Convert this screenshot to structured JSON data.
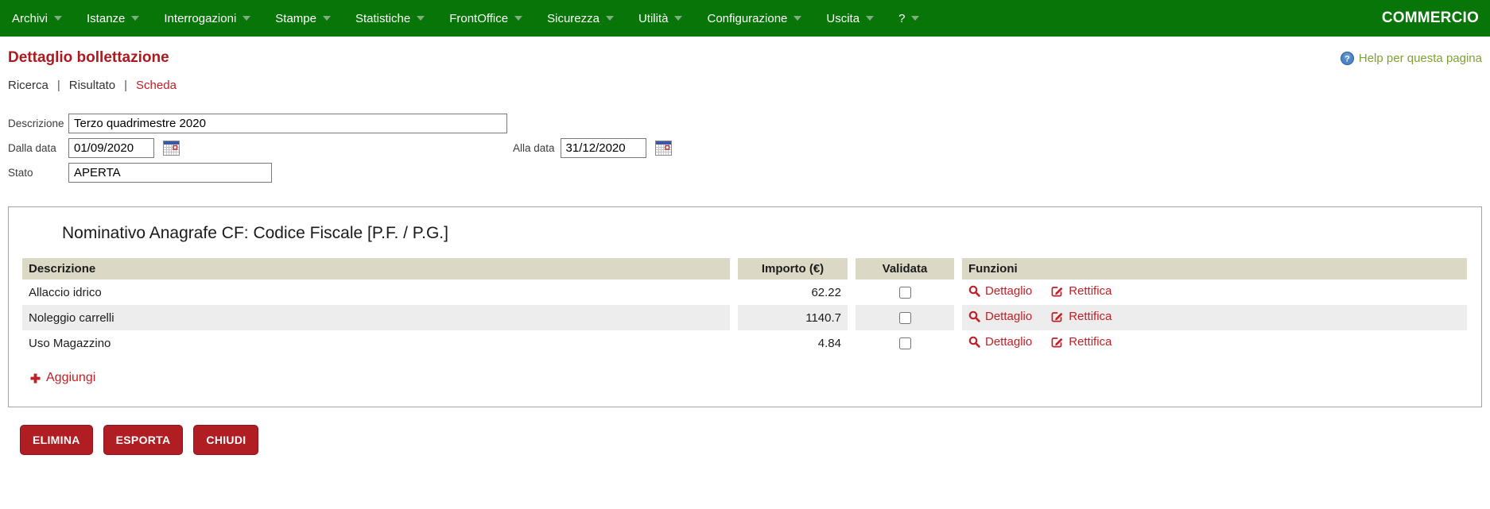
{
  "menu": {
    "items": [
      {
        "id": "archivi",
        "label": "Archivi"
      },
      {
        "id": "istanze",
        "label": "Istanze"
      },
      {
        "id": "interrogazioni",
        "label": "Interrogazioni"
      },
      {
        "id": "stampe",
        "label": "Stampe"
      },
      {
        "id": "statistiche",
        "label": "Statistiche"
      },
      {
        "id": "frontoffice",
        "label": "FrontOffice"
      },
      {
        "id": "sicurezza",
        "label": "Sicurezza"
      },
      {
        "id": "utilita",
        "label": "Utilità"
      },
      {
        "id": "configurazione",
        "label": "Configurazione"
      },
      {
        "id": "uscita",
        "label": "Uscita"
      },
      {
        "id": "help",
        "label": "?"
      }
    ],
    "brand": "COMMERCIO"
  },
  "header": {
    "title": "Dettaglio bollettazione",
    "help_label": "Help per questa pagina",
    "help_icon": "question-circle-icon"
  },
  "breadcrumb": {
    "separator": "|",
    "items": [
      {
        "id": "ricerca",
        "label": "Ricerca",
        "active": false
      },
      {
        "id": "risultato",
        "label": "Risultato",
        "active": false
      },
      {
        "id": "scheda",
        "label": "Scheda",
        "active": true
      }
    ]
  },
  "form": {
    "descrizione": {
      "label": "Descrizione",
      "value": "Terzo quadrimestre 2020"
    },
    "dalla_data": {
      "label": "Dalla data",
      "value": "01/09/2020",
      "picker_icon": "calendar-icon"
    },
    "alla_data": {
      "label": "Alla data",
      "value": "31/12/2020",
      "picker_icon": "calendar-icon"
    },
    "stato": {
      "label": "Stato",
      "value": "APERTA"
    }
  },
  "panel": {
    "heading": "Nominativo Anagrafe CF: Codice Fiscale [P.F. / P.G.]",
    "table": {
      "columns": [
        "Descrizione",
        "Importo (€)",
        "Validata",
        "Funzioni"
      ],
      "rows": [
        {
          "descrizione": "Allaccio idrico",
          "importo": "62.22",
          "validata": false
        },
        {
          "descrizione": "Noleggio carrelli",
          "importo": "1140.7",
          "validata": false
        },
        {
          "descrizione": "Uso Magazzino",
          "importo": "4.84",
          "validata": false
        }
      ],
      "row_actions": [
        {
          "id": "dettaglio",
          "label": "Dettaglio",
          "icon": "search-icon"
        },
        {
          "id": "rettifica",
          "label": "Rettifica",
          "icon": "edit-icon"
        }
      ]
    },
    "add_link": {
      "label": "Aggiungi",
      "icon": "plus-icon"
    }
  },
  "actions": {
    "buttons": [
      {
        "id": "elimina",
        "label": "ELIMINA"
      },
      {
        "id": "esporta",
        "label": "ESPORTA"
      },
      {
        "id": "chiudi",
        "label": "CHIUDI"
      }
    ]
  },
  "colors": {
    "menu_green": "#077507",
    "accent_red": "#B01D23",
    "link_red": "#C22026",
    "table_header_beige": "#DBD9C6",
    "row_stripe_gray": "#EDEDED",
    "help_green": "#7ea232"
  }
}
